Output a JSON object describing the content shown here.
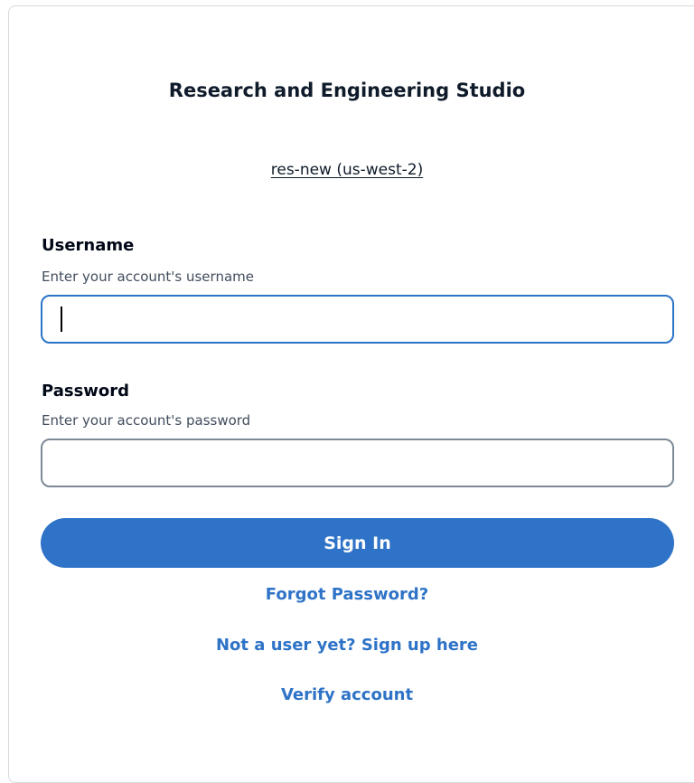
{
  "app": {
    "title": "Research and Engineering Studio",
    "environment_link": "res-new (us-west-2)"
  },
  "form": {
    "username": {
      "label": "Username",
      "description": "Enter your account's username",
      "value": ""
    },
    "password": {
      "label": "Password",
      "description": "Enter your account's password",
      "value": ""
    },
    "submit_label": "Sign In"
  },
  "links": {
    "forgot_password": "Forgot Password?",
    "sign_up": "Not a user yet? Sign up here",
    "verify_account": "Verify account"
  },
  "colors": {
    "accent": "#2e73c7",
    "focus_border": "#2b74c8",
    "input_border": "#7d8998",
    "text": "#0f1b2a"
  }
}
